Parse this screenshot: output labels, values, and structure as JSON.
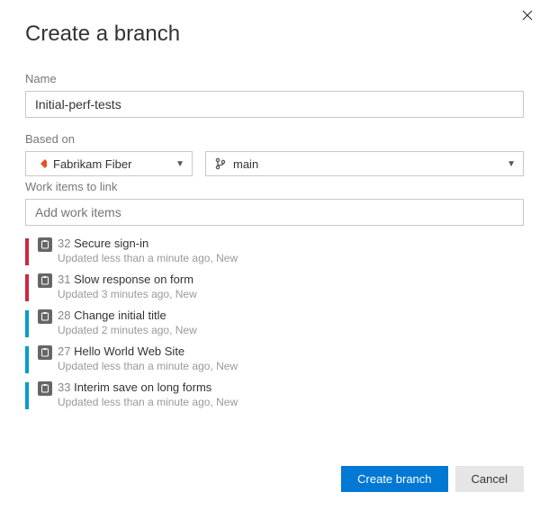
{
  "title": "Create a branch",
  "labels": {
    "name": "Name",
    "based_on": "Based on",
    "work_items": "Work items to link"
  },
  "name_value": "Initial-perf-tests",
  "repo_dropdown": {
    "selected": "Fabrikam Fiber"
  },
  "branch_dropdown": {
    "selected": "main"
  },
  "work_items_placeholder": "Add work items",
  "work_items": [
    {
      "color": "red",
      "id": "32",
      "title": "Secure sign-in",
      "meta": "Updated less than a minute ago, New"
    },
    {
      "color": "red",
      "id": "31",
      "title": "Slow response on form",
      "meta": "Updated 3 minutes ago, New"
    },
    {
      "color": "blue",
      "id": "28",
      "title": "Change initial title",
      "meta": "Updated 2 minutes ago, New"
    },
    {
      "color": "blue",
      "id": "27",
      "title": "Hello World Web Site",
      "meta": "Updated less than a minute ago, New"
    },
    {
      "color": "blue",
      "id": "33",
      "title": "Interim save on long forms",
      "meta": "Updated less than a minute ago, New"
    }
  ],
  "buttons": {
    "primary": "Create branch",
    "secondary": "Cancel"
  }
}
